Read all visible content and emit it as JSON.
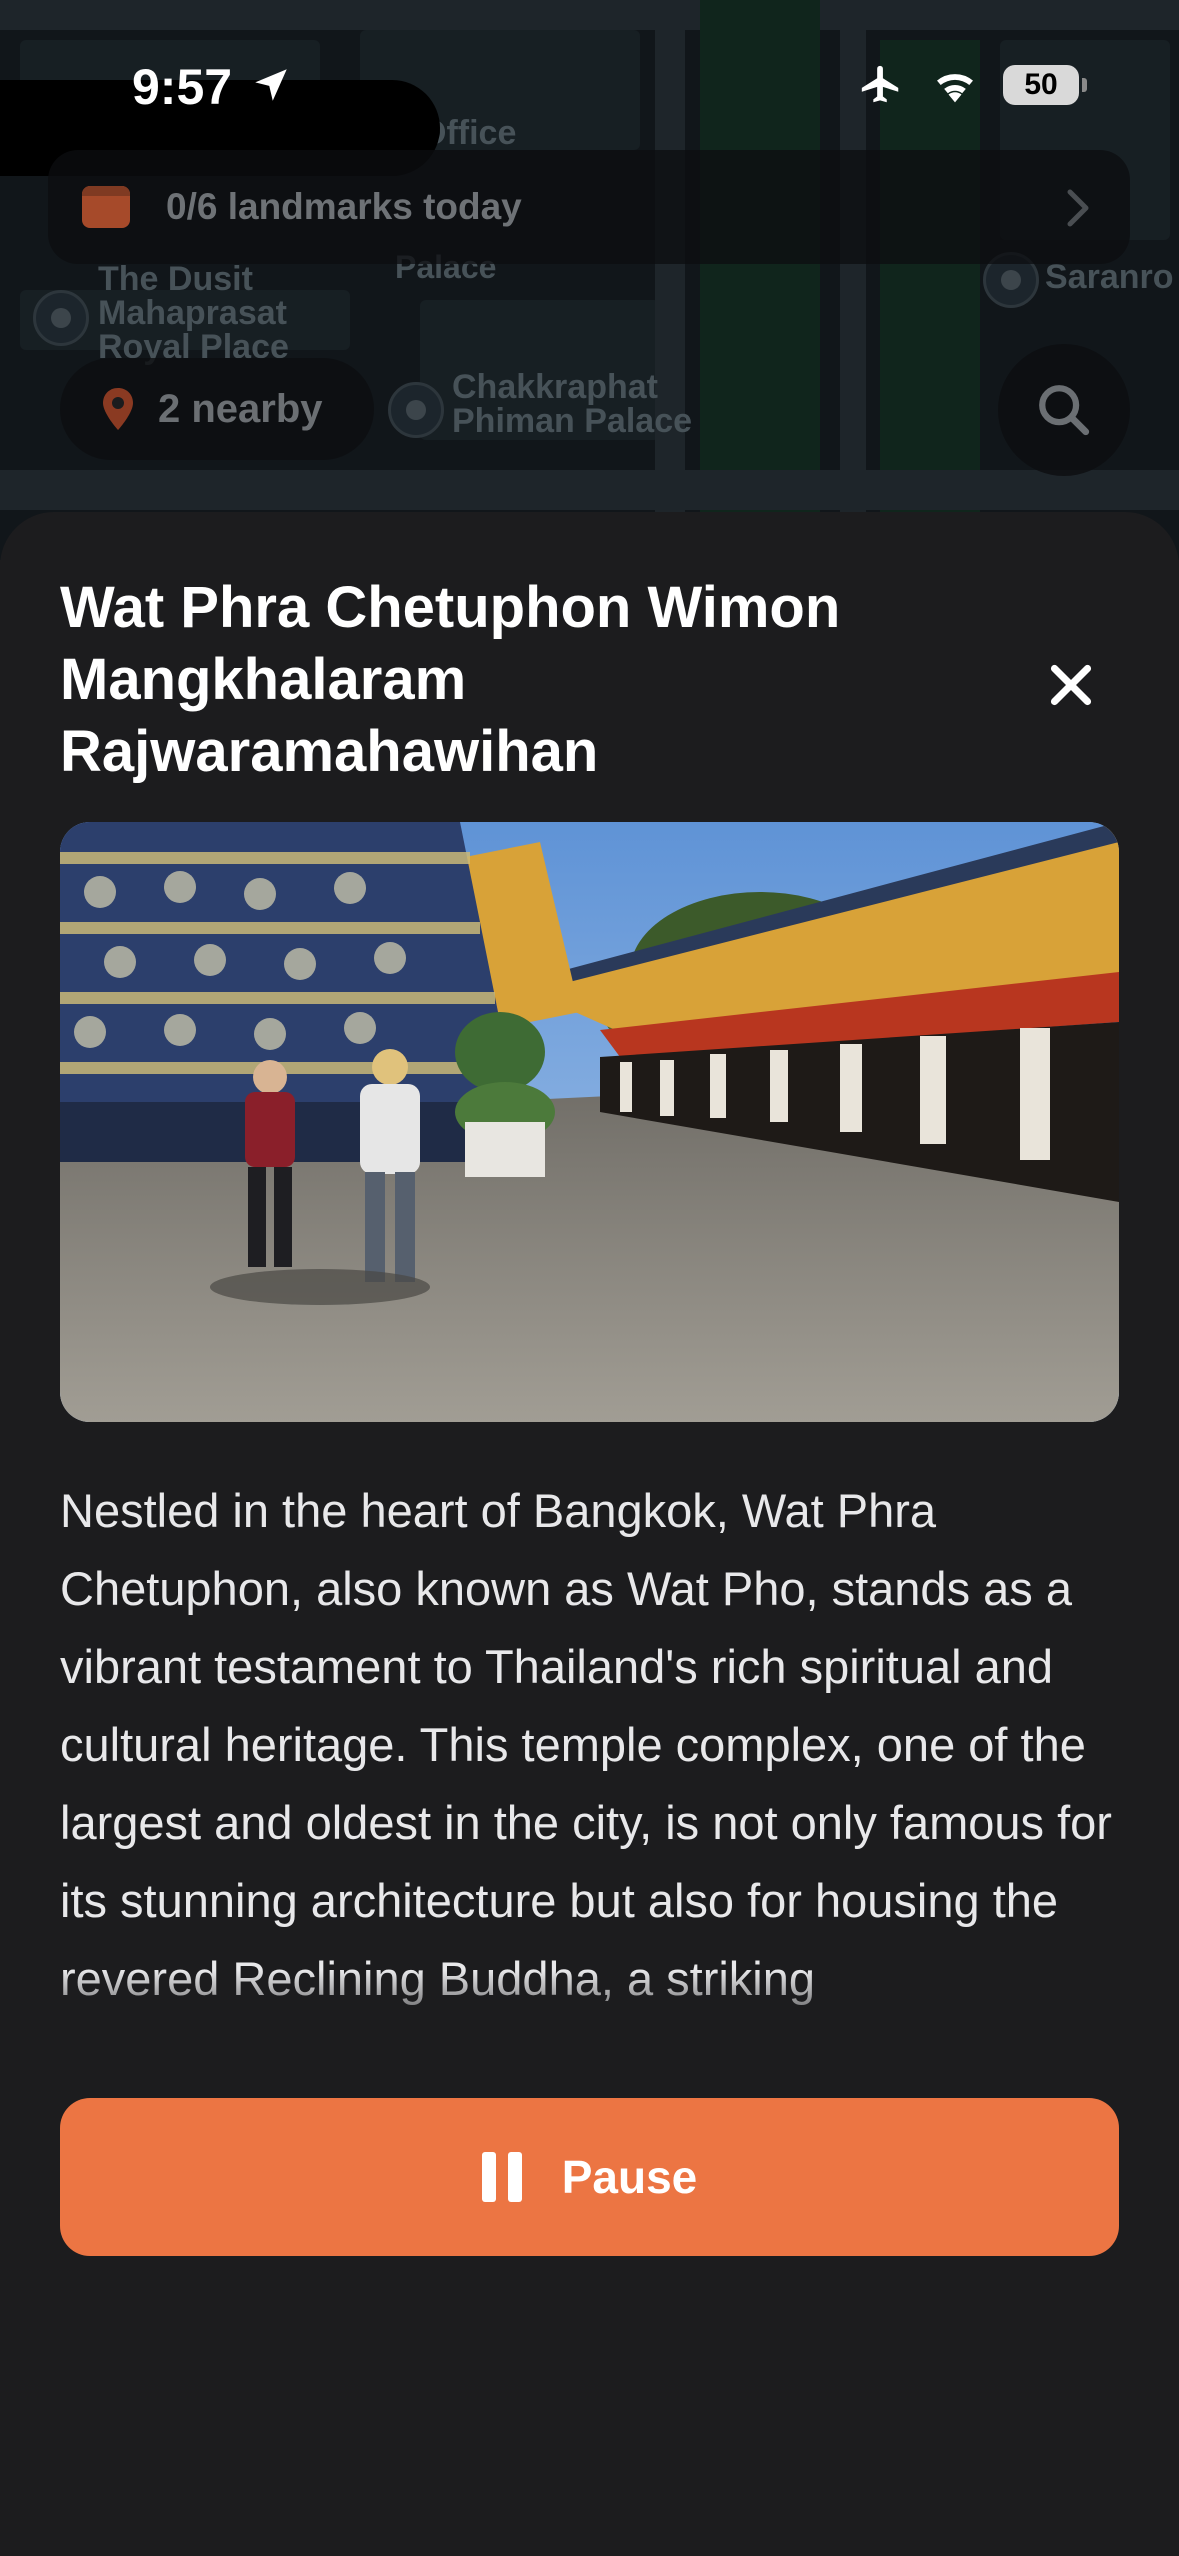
{
  "status_bar": {
    "time": "9:57",
    "battery": "50",
    "icons": [
      "location-arrow-icon",
      "airplane-icon",
      "wifi-icon",
      "battery-icon"
    ]
  },
  "map": {
    "labels": {
      "office": "Office",
      "dusit": "The Dusit\nMahaprasat\nRoyal Place",
      "palace": "Palace",
      "chakkraphat": "Chakkraphat\nPhiman Palace",
      "saranro": "Saranro"
    }
  },
  "landmarks_bar": {
    "text": "0/6 landmarks today",
    "icon": "calendar-icon"
  },
  "nearby": {
    "text": "2 nearby",
    "icon": "pin-icon"
  },
  "sheet": {
    "title": "Wat Phra Chetuphon Wimon Mangkhalaram Rajwaramahawihan",
    "description": "Nestled in the heart of Bangkok, Wat Phra Chetuphon, also known as Wat Pho, stands as a vibrant testament to Thailand's rich spiritual and cultural heritage. This temple complex, one of the largest and oldest in the city, is not only famous for its stunning architecture but also for housing the revered Reclining Buddha, a striking",
    "pause_label": "Pause"
  },
  "colors": {
    "accent": "#ec7543",
    "sheet_bg": "#1c1c1e"
  }
}
